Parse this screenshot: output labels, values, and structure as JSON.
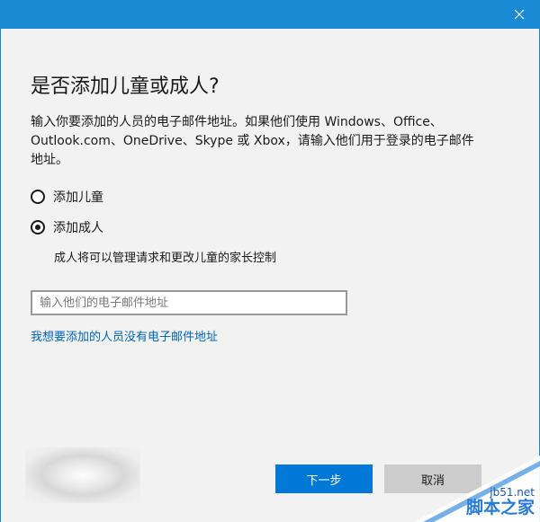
{
  "dialog": {
    "heading": "是否添加儿童或成人?",
    "description": "输入你要添加的人员的电子邮件地址。如果他们使用 Windows、Office、Outlook.com、OneDrive、Skype 或 Xbox，请输入他们用于登录的电子邮件地址。",
    "options": [
      {
        "label": "添加儿童",
        "selected": false
      },
      {
        "label": "添加成人",
        "selected": true
      }
    ],
    "adult_note": "成人将可以管理请求和更改儿童的家长控制",
    "email_placeholder": "输入他们的电子邮件地址",
    "email_value": "",
    "no_email_link": "我想要添加的人员没有电子邮件地址",
    "next_button": "下一步",
    "cancel_button": "取消"
  },
  "watermark": {
    "site": "jb51.net",
    "name": "脚本之家"
  },
  "colors": {
    "titlebar": "#1a8ad4",
    "primary_button": "#0078d7",
    "link": "#0066b4",
    "background": "#f2f2f2"
  },
  "icons": {
    "close": "close-icon",
    "logo": "watermark-logo"
  }
}
